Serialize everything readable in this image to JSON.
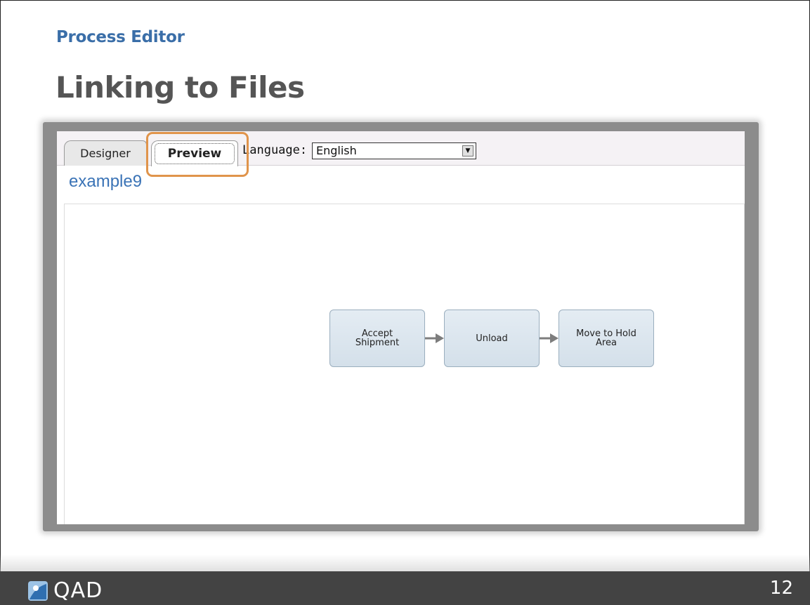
{
  "slide": {
    "section": "Process Editor",
    "title": "Linking to Files",
    "page_number": "12"
  },
  "app": {
    "tabs": [
      {
        "label": "Designer",
        "active": false
      },
      {
        "label": "Preview",
        "active": true
      }
    ],
    "language": {
      "label": "Language:",
      "value": "English"
    },
    "process_name": "example9",
    "nodes": [
      {
        "label": "Accept\nShipment"
      },
      {
        "label": "Unload"
      },
      {
        "label": "Move to Hold\nArea"
      }
    ]
  },
  "footer": {
    "brand": "QAD"
  },
  "colors": {
    "section_title": "#3a6ea8",
    "main_title": "#555555",
    "highlight": "#e0944b",
    "footer_bg": "#434343",
    "node_fill": "#dbe5ee"
  }
}
